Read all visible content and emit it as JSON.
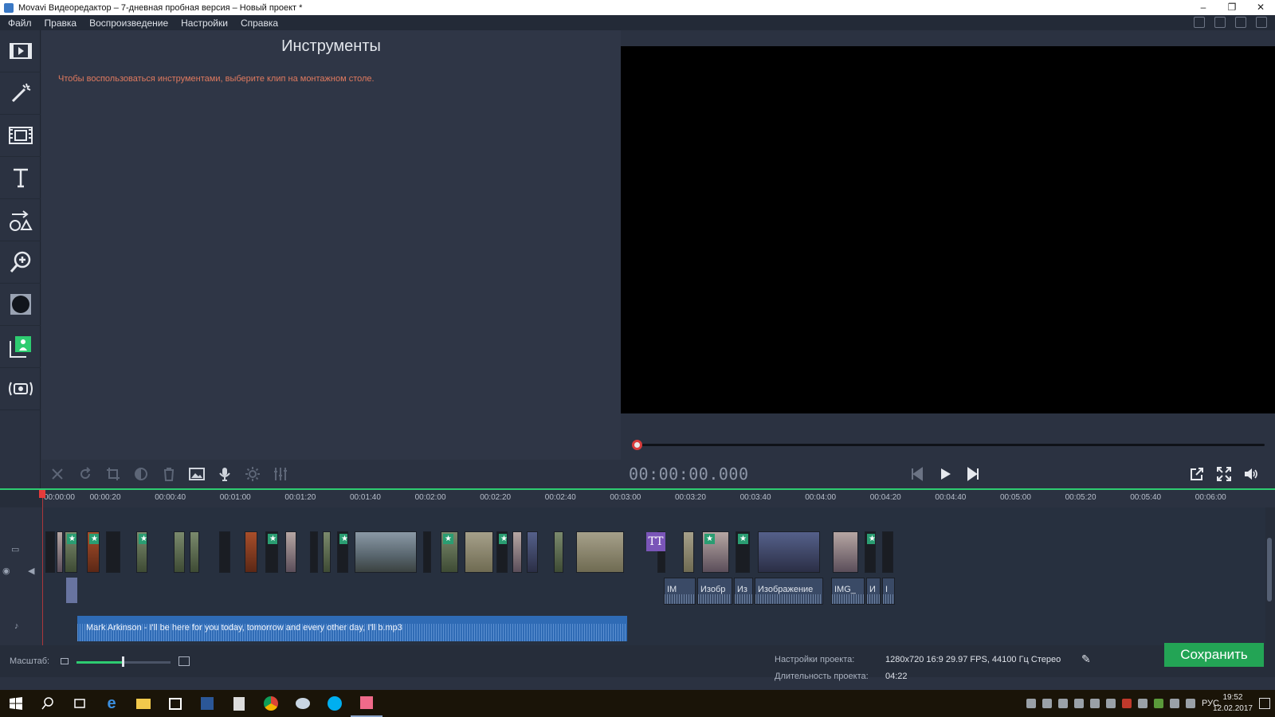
{
  "window": {
    "title": "Movavi Видеоредактор – 7-дневная пробная версия – Новый проект *",
    "controls": [
      "minimize",
      "restore",
      "close"
    ]
  },
  "menu": {
    "items": [
      "Файл",
      "Правка",
      "Воспроизведение",
      "Настройки",
      "Справка"
    ]
  },
  "rail": {
    "icons": [
      "import-icon",
      "magic-wand-icon",
      "filters-icon",
      "titles-icon",
      "shapes-icon",
      "zoom-icon",
      "vignette-icon",
      "chroma-key-icon",
      "record-icon"
    ]
  },
  "tools_panel": {
    "title": "Инструменты",
    "hint": "Чтобы воспользоваться инструментами, выберите клип на монтажном столе."
  },
  "player": {
    "timecode": "00:00:00.000",
    "progress": 0
  },
  "toolbar": {
    "buttons": [
      "cut-icon",
      "rotate-icon",
      "crop-icon",
      "color-icon",
      "delete-icon",
      "image-icon",
      "mic-icon",
      "settings-icon",
      "equalizer-icon"
    ]
  },
  "timeline": {
    "ticks": [
      "00:00:00",
      "00:00:20",
      "00:00:40",
      "00:01:00",
      "00:01:20",
      "00:01:40",
      "00:02:00",
      "00:02:20",
      "00:02:40",
      "00:03:00",
      "00:03:20",
      "00:03:40",
      "00:04:00",
      "00:04:20",
      "00:04:40",
      "00:05:00",
      "00:05:20",
      "00:05:40",
      "00:06:00"
    ],
    "title_clip_glyph": "TT",
    "image_labels": [
      "IM",
      "Изобр",
      "Из",
      "Изображение",
      "IMG_",
      "И",
      "I"
    ],
    "audio_label": "Mark Arkinson - I'll be here for you today, tomorrow and every other day, I'll b.mp3",
    "star": "★"
  },
  "status": {
    "zoom_label": "Масштаб:",
    "zoom_level": 0.48,
    "project_settings_label": "Настройки проекта:",
    "project_settings_value": "1280x720 16:9 29.97 FPS, 44100 Гц Стерео",
    "duration_label": "Длительность проекта:",
    "duration_value": "04:22",
    "save_label": "Сохранить"
  },
  "taskbar": {
    "lang": "РУС",
    "time": "19:52",
    "date": "12.02.2017"
  },
  "colors": {
    "accent": "#2ecc71",
    "save": "#23a455",
    "playhead": "#e63b3b",
    "hint": "#e07a5f",
    "audio": "#2f6bb5"
  }
}
